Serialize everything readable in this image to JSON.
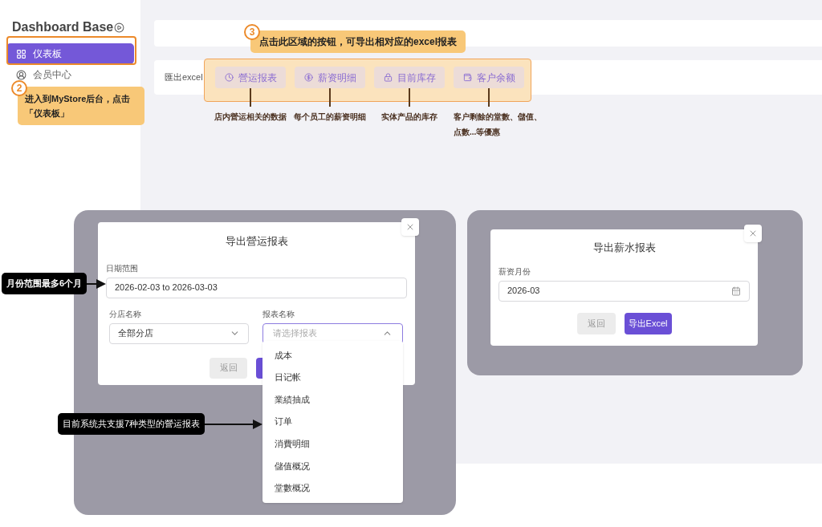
{
  "sidebar": {
    "title": "Dashboard Base",
    "items": [
      {
        "label": "仪表板",
        "selected": true
      },
      {
        "label": "会员中心",
        "selected": false
      }
    ]
  },
  "export_bar": {
    "label": "匯出excel",
    "buttons": [
      {
        "label": "營运报表",
        "description": "店内營运相关的数据"
      },
      {
        "label": "薪资明细",
        "description": "每个员工的薪资明细"
      },
      {
        "label": "目前库存",
        "description": "实体产品的库存"
      },
      {
        "label": "客户余额",
        "description": "客户剩餘的堂數、儲值、点數...等優惠"
      }
    ]
  },
  "callouts": [
    {
      "number": "2",
      "text": "进入到MyStore后台，点击「仪表板」"
    },
    {
      "number": "3",
      "text": "点击此区域的按钮，可导出相对应的excel报表"
    }
  ],
  "notes": [
    "月份范围最多6个月",
    "目前系统共支援7种类型的營运报表"
  ],
  "operations_dialog": {
    "title": "导出營运报表",
    "date_range": {
      "label": "日期范围",
      "value": "2026-02-03 to 2026-03-03"
    },
    "branch": {
      "label": "分店名称",
      "value": "全部分店"
    },
    "report": {
      "label": "报表名称",
      "placeholder": "请选择报表",
      "expanded": true
    },
    "back_button": "返回",
    "options": [
      "成本",
      "日记帐",
      "業績抽成",
      "订单",
      "消費明细",
      "儲值概况",
      "堂數概况"
    ]
  },
  "salary_dialog": {
    "title": "导出薪水报表",
    "month": {
      "label": "薪资月份",
      "value": "2026-03"
    },
    "back_button": "返回",
    "export_button": "导出Excel"
  }
}
